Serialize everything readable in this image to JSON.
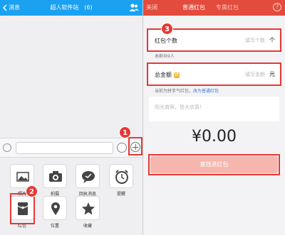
{
  "left": {
    "topbar": {
      "back_label": "消息",
      "title": "超人软件站",
      "count": "(6)"
    },
    "tools": [
      {
        "label": "照片"
      },
      {
        "label": "拍摄"
      },
      {
        "label": "回执消息"
      },
      {
        "label": "提醒"
      },
      {
        "label": "红包"
      },
      {
        "label": "位置"
      },
      {
        "label": "收藏"
      }
    ]
  },
  "right": {
    "topbar": {
      "close_label": "关闭",
      "tabs": [
        "普通红包",
        "专属红包"
      ],
      "help": "?"
    },
    "count_field": {
      "label": "红包个数",
      "placeholder": "填写个数",
      "unit": "个"
    },
    "group_note": "本群共9人",
    "amount_field": {
      "label": "总金额",
      "badge": "拼",
      "placeholder": "填写金额",
      "unit": "元"
    },
    "pin_note": "当前为拼手气红包，",
    "pin_link": "改为普通红包",
    "message_placeholder": "阳光普照，皆大欢喜！",
    "amount_display": "¥0.00",
    "send_button": "塞钱进红包"
  },
  "badges": [
    "1",
    "2",
    "3"
  ],
  "colors": {
    "qq_blue": "#1ba1f2",
    "hongbao_red": "#e34b3c",
    "highlight": "#e53935",
    "send_disabled": "#f6b6ad"
  }
}
